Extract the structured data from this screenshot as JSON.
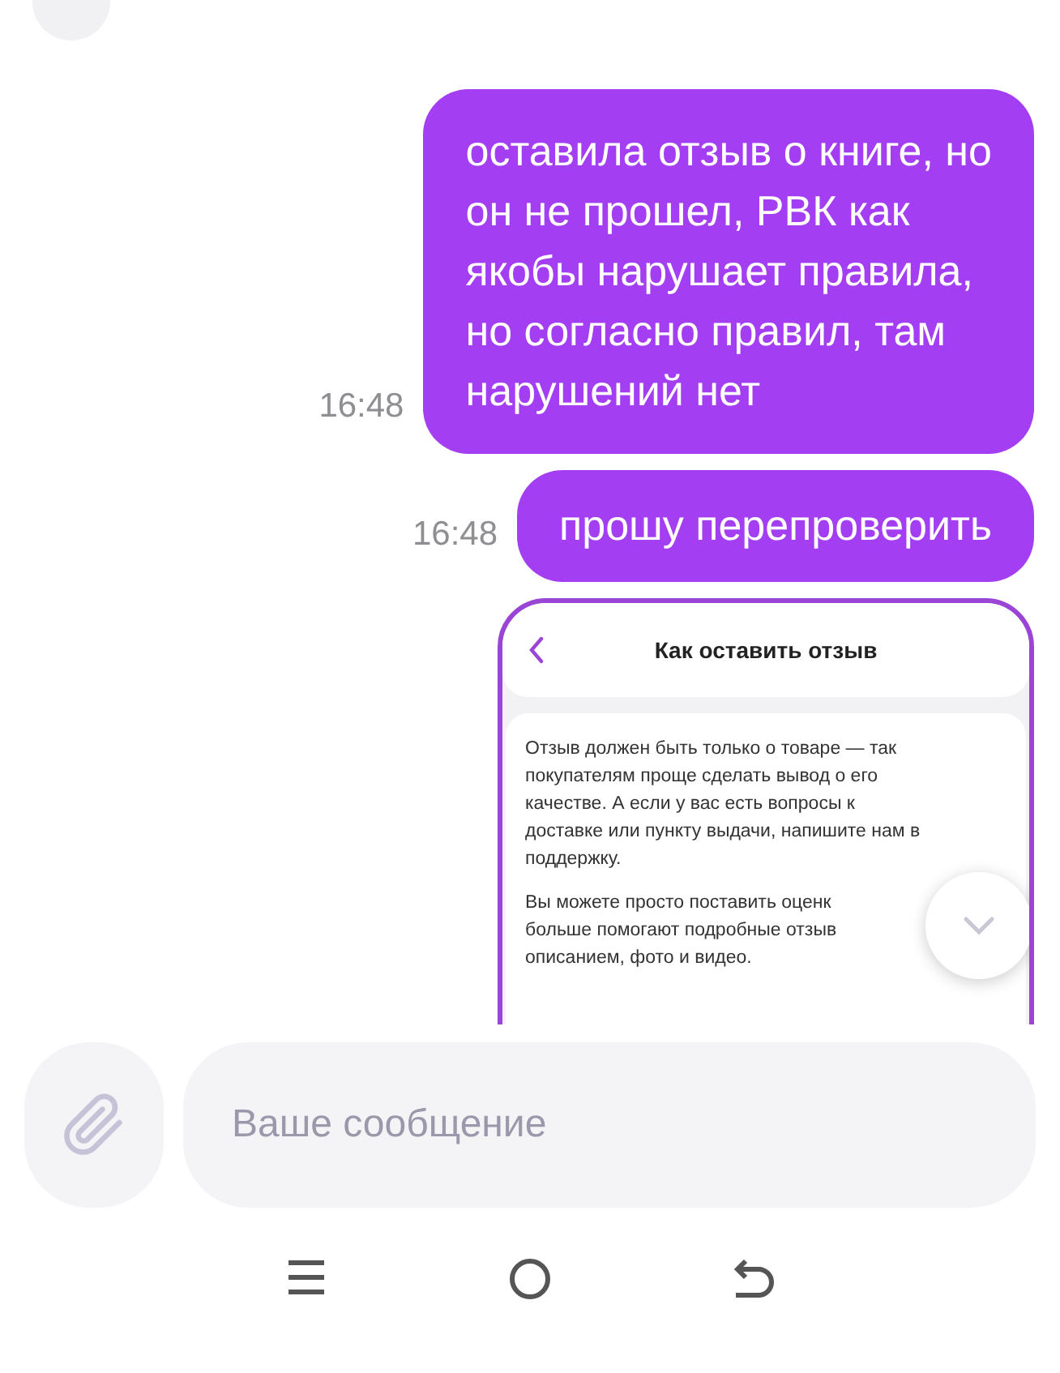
{
  "messages": [
    {
      "kind": "text",
      "time": "16:48",
      "lines": [
        "оставила отзыв о книге, но",
        "он не прошел, РВК как",
        "якобы нарушает правила,",
        "но согласно правил, там",
        "нарушений нет"
      ]
    },
    {
      "kind": "text",
      "time": "16:48",
      "lines": [
        "прошу перепроверить"
      ]
    },
    {
      "kind": "screenshot",
      "title": "Как оставить отзыв",
      "paragraphs": [
        {
          "lines": [
            "Отзыв должен быть только о товаре — так",
            "покупателям проще сделать вывод о его",
            "качестве. А если у вас есть вопросы к",
            "доставке или пункту выдачи, напишите нам в",
            "поддержку."
          ]
        },
        {
          "lines": [
            "Вы можете просто поставить оценк",
            "больше помогают подробные отзыв",
            "описанием, фото и видео."
          ]
        }
      ]
    }
  ],
  "composer": {
    "placeholder": "Ваше сообщение"
  }
}
